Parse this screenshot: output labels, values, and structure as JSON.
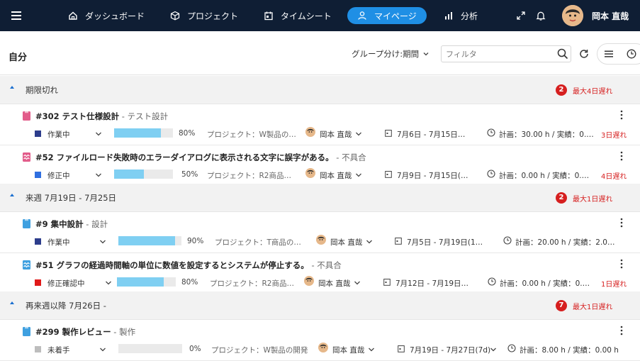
{
  "nav": {
    "items": [
      {
        "label": "ダッシュボード",
        "icon": "home-icon"
      },
      {
        "label": "プロジェクト",
        "icon": "cube-icon"
      },
      {
        "label": "タイムシート",
        "icon": "calendar-icon"
      },
      {
        "label": "マイページ",
        "icon": "user-icon",
        "active": true
      },
      {
        "label": "分析",
        "icon": "bar-chart-icon"
      }
    ],
    "user_name": "岡本 直哉"
  },
  "header": {
    "title": "自分",
    "group_by": "グループ分け:期間",
    "filter_placeholder": "フィルタ"
  },
  "sections": [
    {
      "label": "期限切れ",
      "count": "2",
      "late": "最大4日遅れ",
      "tasks": [
        {
          "title": "#302 テスト仕様設計",
          "category": " - テスト設計",
          "icon": "document-icon",
          "status": "作業中",
          "status_color": "#2d3d8c",
          "progress_pct": "80%",
          "progress": 80,
          "project": "プロジェクト：W製品の…",
          "assignee": "岡本 直哉",
          "dates": "7月6日 - 7月15日…",
          "work": "計画：30.00 h / 実績：0.…",
          "late": "3日遅れ"
        },
        {
          "title": "#52 ファイルロード失敗時のエラーダイアログに表示される文字に誤字がある。",
          "category": " - 不具合",
          "icon": "bug-icon",
          "status": "修正中",
          "status_color": "#2f6fe0",
          "progress_pct": "50%",
          "progress": 50,
          "project": "プロジェクト：R2商品…",
          "assignee": "岡本 直哉",
          "dates": "7月9日 - 7月15日(…",
          "work": "計画：0.00 h / 実績：0.…",
          "late": "4日遅れ"
        }
      ]
    },
    {
      "label": "来週 7月19日 - 7月25日",
      "count": "2",
      "late": "最大1日遅れ",
      "tasks": [
        {
          "title": "#9 集中設計",
          "category": " - 設計",
          "icon": "document-icon",
          "status": "作業中",
          "status_color": "#2d3d8c",
          "progress_pct": "90%",
          "progress": 90,
          "project": "プロジェクト：T商品の…",
          "assignee": "岡本 直哉",
          "dates": "7月5日 - 7月19日(1…",
          "work": "計画：20.00 h / 実績：2.0…",
          "late": ""
        },
        {
          "title": "#51 グラフの経過時間軸の単位に数値を設定するとシステムが停止する。",
          "category": " - 不具合",
          "icon": "bug-icon",
          "status": "修正確認中",
          "status_color": "#e01a1a",
          "progress_pct": "80%",
          "progress": 80,
          "project": "プロジェクト：R2商品…",
          "assignee": "岡本 直哉",
          "dates": "7月12日 - 7月19日…",
          "work": "計画：0.00 h / 実績：0.…",
          "late": "1日遅れ"
        }
      ]
    },
    {
      "label": "再来週以降 7月26日 -",
      "count": "7",
      "late": "最大1日遅れ",
      "tasks": [
        {
          "title": "#299 製作レビュー",
          "category": " - 製作",
          "icon": "document-icon",
          "status": "未着手",
          "status_color": "#bdbdbd",
          "progress_pct": "0%",
          "progress": 0,
          "project": "プロジェクト：W製品の開発",
          "assignee": "岡本 直哉",
          "dates": "7月19日 - 7月27日(7d)",
          "work": "計画：8.00 h / 実績：0.00 h",
          "late": ""
        }
      ]
    }
  ]
}
